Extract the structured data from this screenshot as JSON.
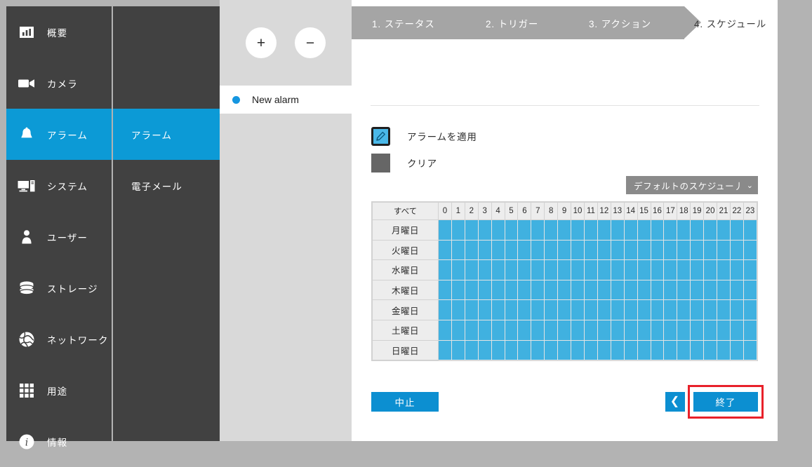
{
  "sidebar": {
    "items": [
      {
        "label": "概要",
        "icon": "chart-bar-icon",
        "active": false
      },
      {
        "label": "カメラ",
        "icon": "video-camera-icon",
        "active": false
      },
      {
        "label": "アラーム",
        "icon": "bell-icon",
        "active": true
      },
      {
        "label": "システム",
        "icon": "desktop-tower-icon",
        "active": false
      },
      {
        "label": "ユーザー",
        "icon": "user-icon",
        "active": false
      },
      {
        "label": "ストレージ",
        "icon": "database-icon",
        "active": false
      },
      {
        "label": "ネットワーク",
        "icon": "globe-icon",
        "active": false
      },
      {
        "label": "用途",
        "icon": "grid-apps-icon",
        "active": false
      },
      {
        "label": "情報",
        "icon": "info-circle-icon",
        "active": false
      }
    ]
  },
  "subnav": {
    "items": [
      {
        "label": "アラーム",
        "active": true
      },
      {
        "label": "電子メール",
        "active": false
      }
    ]
  },
  "alarm_list": {
    "add_label": "+",
    "remove_label": "−",
    "items": [
      {
        "name": "New alarm",
        "status_color": "#1596e0"
      }
    ]
  },
  "wizard": {
    "steps": [
      {
        "label": "1. ステータス",
        "state": "done"
      },
      {
        "label": "2. トリガー",
        "state": "done"
      },
      {
        "label": "3. アクション",
        "state": "done"
      },
      {
        "label": "4. スケジュール",
        "state": "current"
      }
    ]
  },
  "legend": {
    "apply": {
      "label": "アラームを適用",
      "color": "#4ab8e8",
      "selected": true
    },
    "clear": {
      "label": "クリア",
      "color": "#666666",
      "selected": false
    }
  },
  "preset": {
    "value": "デフォルトのスケジュー丿",
    "caret": "⌄"
  },
  "schedule": {
    "all_label": "すべて",
    "hours": [
      "0",
      "1",
      "2",
      "3",
      "4",
      "5",
      "6",
      "7",
      "8",
      "9",
      "10",
      "11",
      "12",
      "13",
      "14",
      "15",
      "16",
      "17",
      "18",
      "19",
      "20",
      "21",
      "22",
      "23"
    ],
    "days": [
      {
        "label": "月曜日",
        "slots": [
          1,
          1,
          1,
          1,
          1,
          1,
          1,
          1,
          1,
          1,
          1,
          1,
          1,
          1,
          1,
          1,
          1,
          1,
          1,
          1,
          1,
          1,
          1,
          1
        ]
      },
      {
        "label": "火曜日",
        "slots": [
          1,
          1,
          1,
          1,
          1,
          1,
          1,
          1,
          1,
          1,
          1,
          1,
          1,
          1,
          1,
          1,
          1,
          1,
          1,
          1,
          1,
          1,
          1,
          1
        ]
      },
      {
        "label": "水曜日",
        "slots": [
          1,
          1,
          1,
          1,
          1,
          1,
          1,
          1,
          1,
          1,
          1,
          1,
          1,
          1,
          1,
          1,
          1,
          1,
          1,
          1,
          1,
          1,
          1,
          1
        ]
      },
      {
        "label": "木曜日",
        "slots": [
          1,
          1,
          1,
          1,
          1,
          1,
          1,
          1,
          1,
          1,
          1,
          1,
          1,
          1,
          1,
          1,
          1,
          1,
          1,
          1,
          1,
          1,
          1,
          1
        ]
      },
      {
        "label": "金曜日",
        "slots": [
          1,
          1,
          1,
          1,
          1,
          1,
          1,
          1,
          1,
          1,
          1,
          1,
          1,
          1,
          1,
          1,
          1,
          1,
          1,
          1,
          1,
          1,
          1,
          1
        ]
      },
      {
        "label": "土曜日",
        "slots": [
          1,
          1,
          1,
          1,
          1,
          1,
          1,
          1,
          1,
          1,
          1,
          1,
          1,
          1,
          1,
          1,
          1,
          1,
          1,
          1,
          1,
          1,
          1,
          1
        ]
      },
      {
        "label": "日曜日",
        "slots": [
          1,
          1,
          1,
          1,
          1,
          1,
          1,
          1,
          1,
          1,
          1,
          1,
          1,
          1,
          1,
          1,
          1,
          1,
          1,
          1,
          1,
          1,
          1,
          1
        ]
      }
    ]
  },
  "footer": {
    "cancel_label": "中止",
    "back_label": "❮",
    "finish_label": "終了",
    "highlight_color": "#e8212a"
  },
  "colors": {
    "accent": "#0c9ad6",
    "panel_dark": "#414141",
    "slot_on": "#40b1e0"
  }
}
